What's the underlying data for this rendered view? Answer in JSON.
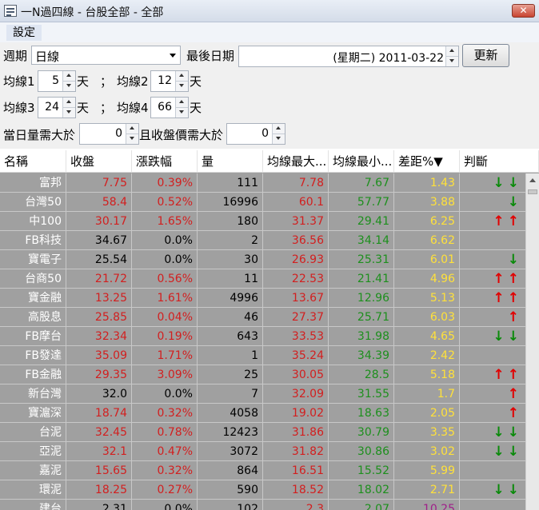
{
  "window": {
    "title": "一N過四線 - 台股全部 - 全部",
    "close_label": "✕"
  },
  "menu": {
    "settings": "設定"
  },
  "controls": {
    "period_label": "週期",
    "period_value": "日線",
    "last_date_label": "最後日期",
    "last_date_value": "(星期二) 2011-03-22",
    "refresh_label": "更新",
    "ma1_label": "均線1",
    "ma1_value": "5",
    "ma1_unit": "天",
    "sep1": "；",
    "ma2_label": "均線2",
    "ma2_value": "12",
    "ma2_unit": "天",
    "ma3_label": "均線3",
    "ma3_value": "24",
    "ma3_unit": "天",
    "sep2": "；",
    "ma4_label": "均線4",
    "ma4_value": "66",
    "ma4_unit": "天",
    "vol_label": "當日量需大於",
    "vol_value": "0",
    "close_label": "且收盤價需大於",
    "close_value": "0"
  },
  "table": {
    "columns": [
      "名稱",
      "收盤",
      "漲跌幅",
      "量",
      "均線最大...",
      "均線最小...",
      "差距%▼",
      "判斷"
    ],
    "rows": [
      {
        "name": "富邦",
        "close": "7.75",
        "chg": "0.39%",
        "vol": "111",
        "max": "7.78",
        "min": "7.67",
        "gap": "1.43",
        "sig": "↓↓",
        "close_color": "#d21f1f",
        "chg_color": "#d21f1f",
        "max_color": "#d21f1f",
        "min_color": "#1d8f1d",
        "gap_color": "#ffe13a",
        "sig_color": "#0a8a0a"
      },
      {
        "name": "台灣50",
        "close": "58.4",
        "chg": "0.52%",
        "vol": "16996",
        "max": "60.1",
        "min": "57.77",
        "gap": "3.88",
        "sig": "↓",
        "close_color": "#d21f1f",
        "chg_color": "#d21f1f",
        "max_color": "#d21f1f",
        "min_color": "#1d8f1d",
        "gap_color": "#ffe13a",
        "sig_color": "#0a8a0a"
      },
      {
        "name": "中100",
        "close": "30.17",
        "chg": "1.65%",
        "vol": "180",
        "max": "31.37",
        "min": "29.41",
        "gap": "6.25",
        "sig": "↑↑",
        "close_color": "#d21f1f",
        "chg_color": "#d21f1f",
        "max_color": "#d21f1f",
        "min_color": "#1d8f1d",
        "gap_color": "#ffe13a",
        "sig_color": "#e10000"
      },
      {
        "name": "FB科技",
        "close": "34.67",
        "chg": "0.0%",
        "vol": "2",
        "max": "36.56",
        "min": "34.14",
        "gap": "6.62",
        "sig": "",
        "close_color": "#000000",
        "chg_color": "#000000",
        "max_color": "#d21f1f",
        "min_color": "#1d8f1d",
        "gap_color": "#ffe13a",
        "sig_color": "#0a8a0a"
      },
      {
        "name": "寶電子",
        "close": "25.54",
        "chg": "0.0%",
        "vol": "30",
        "max": "26.93",
        "min": "25.31",
        "gap": "6.01",
        "sig": "↓",
        "close_color": "#000000",
        "chg_color": "#000000",
        "max_color": "#d21f1f",
        "min_color": "#1d8f1d",
        "gap_color": "#ffe13a",
        "sig_color": "#0a8a0a"
      },
      {
        "name": "台商50",
        "close": "21.72",
        "chg": "0.56%",
        "vol": "11",
        "max": "22.53",
        "min": "21.41",
        "gap": "4.96",
        "sig": "↑↑",
        "close_color": "#d21f1f",
        "chg_color": "#d21f1f",
        "max_color": "#d21f1f",
        "min_color": "#1d8f1d",
        "gap_color": "#ffe13a",
        "sig_color": "#e10000"
      },
      {
        "name": "寶金融",
        "close": "13.25",
        "chg": "1.61%",
        "vol": "4996",
        "max": "13.67",
        "min": "12.96",
        "gap": "5.13",
        "sig": "↑↑",
        "close_color": "#d21f1f",
        "chg_color": "#d21f1f",
        "max_color": "#d21f1f",
        "min_color": "#1d8f1d",
        "gap_color": "#ffe13a",
        "sig_color": "#e10000"
      },
      {
        "name": "高股息",
        "close": "25.85",
        "chg": "0.04%",
        "vol": "46",
        "max": "27.37",
        "min": "25.71",
        "gap": "6.03",
        "sig": "↑",
        "close_color": "#d21f1f",
        "chg_color": "#d21f1f",
        "max_color": "#d21f1f",
        "min_color": "#1d8f1d",
        "gap_color": "#ffe13a",
        "sig_color": "#e10000"
      },
      {
        "name": "FB摩台",
        "close": "32.34",
        "chg": "0.19%",
        "vol": "643",
        "max": "33.53",
        "min": "31.98",
        "gap": "4.65",
        "sig": "↓↓",
        "close_color": "#d21f1f",
        "chg_color": "#d21f1f",
        "max_color": "#d21f1f",
        "min_color": "#1d8f1d",
        "gap_color": "#ffe13a",
        "sig_color": "#0a8a0a"
      },
      {
        "name": "FB發達",
        "close": "35.09",
        "chg": "1.71%",
        "vol": "1",
        "max": "35.24",
        "min": "34.39",
        "gap": "2.42",
        "sig": "",
        "close_color": "#d21f1f",
        "chg_color": "#d21f1f",
        "max_color": "#d21f1f",
        "min_color": "#1d8f1d",
        "gap_color": "#ffe13a",
        "sig_color": "#0a8a0a"
      },
      {
        "name": "FB金融",
        "close": "29.35",
        "chg": "3.09%",
        "vol": "25",
        "max": "30.05",
        "min": "28.5",
        "gap": "5.18",
        "sig": "↑↑",
        "close_color": "#d21f1f",
        "chg_color": "#d21f1f",
        "max_color": "#d21f1f",
        "min_color": "#1d8f1d",
        "gap_color": "#ffe13a",
        "sig_color": "#e10000"
      },
      {
        "name": "新台灣",
        "close": "32.0",
        "chg": "0.0%",
        "vol": "7",
        "max": "32.09",
        "min": "31.55",
        "gap": "1.7",
        "sig": "↑",
        "close_color": "#000000",
        "chg_color": "#000000",
        "max_color": "#d21f1f",
        "min_color": "#1d8f1d",
        "gap_color": "#ffe13a",
        "sig_color": "#e10000"
      },
      {
        "name": "寶滬深",
        "close": "18.74",
        "chg": "0.32%",
        "vol": "4058",
        "max": "19.02",
        "min": "18.63",
        "gap": "2.05",
        "sig": "↑",
        "close_color": "#d21f1f",
        "chg_color": "#d21f1f",
        "max_color": "#d21f1f",
        "min_color": "#1d8f1d",
        "gap_color": "#ffe13a",
        "sig_color": "#e10000"
      },
      {
        "name": "台泥",
        "close": "32.45",
        "chg": "0.78%",
        "vol": "12423",
        "max": "31.86",
        "min": "30.79",
        "gap": "3.35",
        "sig": "↓↓",
        "close_color": "#d21f1f",
        "chg_color": "#d21f1f",
        "max_color": "#d21f1f",
        "min_color": "#1d8f1d",
        "gap_color": "#ffe13a",
        "sig_color": "#0a8a0a"
      },
      {
        "name": "亞泥",
        "close": "32.1",
        "chg": "0.47%",
        "vol": "3072",
        "max": "31.82",
        "min": "30.86",
        "gap": "3.02",
        "sig": "↓↓",
        "close_color": "#d21f1f",
        "chg_color": "#d21f1f",
        "max_color": "#d21f1f",
        "min_color": "#1d8f1d",
        "gap_color": "#ffe13a",
        "sig_color": "#0a8a0a"
      },
      {
        "name": "嘉泥",
        "close": "15.65",
        "chg": "0.32%",
        "vol": "864",
        "max": "16.51",
        "min": "15.52",
        "gap": "5.99",
        "sig": "",
        "close_color": "#d21f1f",
        "chg_color": "#d21f1f",
        "max_color": "#d21f1f",
        "min_color": "#1d8f1d",
        "gap_color": "#ffe13a",
        "sig_color": "#0a8a0a"
      },
      {
        "name": "環泥",
        "close": "18.25",
        "chg": "0.27%",
        "vol": "590",
        "max": "18.52",
        "min": "18.02",
        "gap": "2.71",
        "sig": "↓↓",
        "close_color": "#d21f1f",
        "chg_color": "#d21f1f",
        "max_color": "#d21f1f",
        "min_color": "#1d8f1d",
        "gap_color": "#ffe13a",
        "sig_color": "#0a8a0a"
      },
      {
        "name": "建台",
        "close": "2.31",
        "chg": "0.0%",
        "vol": "102",
        "max": "2.3",
        "min": "2.07",
        "gap": "10.25",
        "sig": "",
        "close_color": "#000000",
        "chg_color": "#000000",
        "max_color": "#d21f1f",
        "min_color": "#1d8f1d",
        "gap_color": "#a0208a",
        "sig_color": "#0a8a0a"
      }
    ]
  }
}
